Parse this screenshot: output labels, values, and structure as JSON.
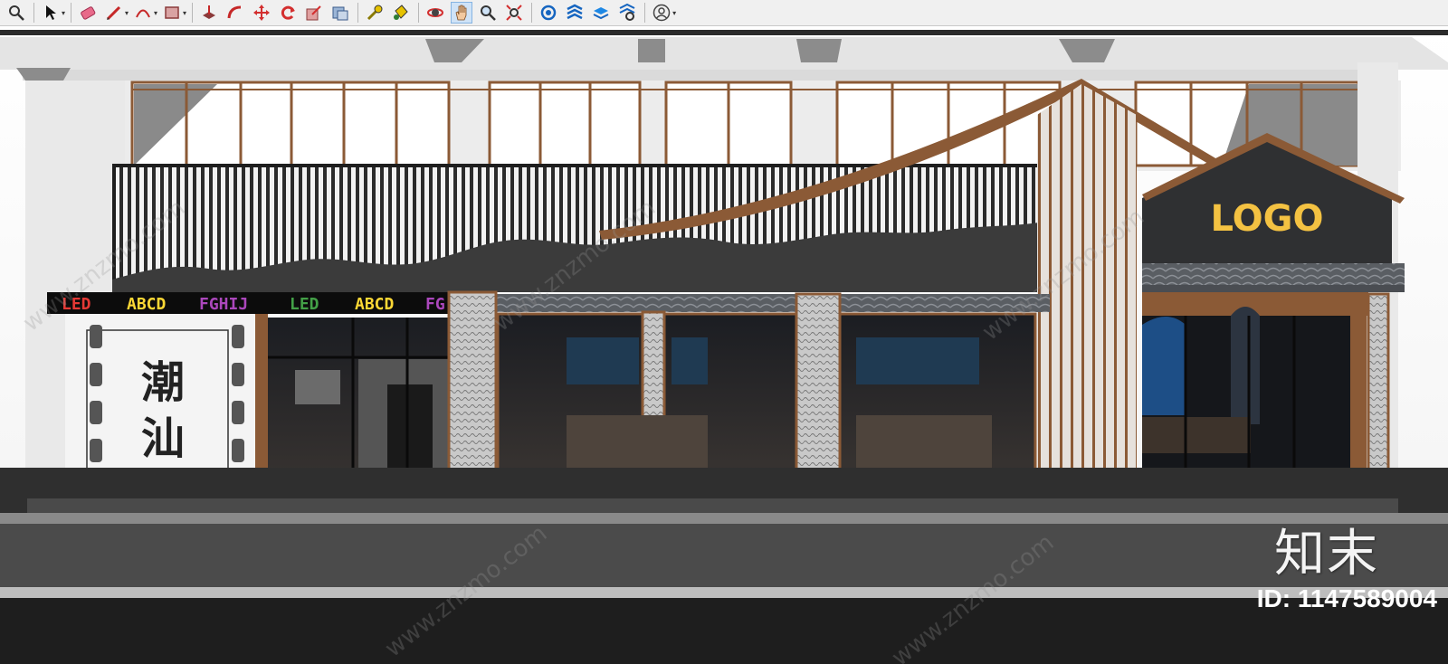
{
  "toolbar": {
    "tools": [
      {
        "name": "zoom-icon"
      },
      {
        "name": "select-icon"
      },
      {
        "name": "eraser-icon"
      },
      {
        "name": "pencil-icon"
      },
      {
        "name": "arc-icon"
      },
      {
        "name": "rectangle-icon"
      },
      {
        "name": "push-pull-icon"
      },
      {
        "name": "follow-me-icon"
      },
      {
        "name": "move-icon"
      },
      {
        "name": "rotate-icon"
      },
      {
        "name": "scale-icon"
      },
      {
        "name": "offset-icon"
      },
      {
        "name": "tape-measure-icon"
      },
      {
        "name": "paint-bucket-icon"
      },
      {
        "name": "orbit-icon"
      },
      {
        "name": "pan-icon"
      },
      {
        "name": "zoom-window-icon"
      },
      {
        "name": "zoom-extents-icon"
      },
      {
        "name": "warehouse-icon"
      },
      {
        "name": "extension-warehouse-icon"
      },
      {
        "name": "layout-icon"
      },
      {
        "name": "extension-manager-icon"
      },
      {
        "name": "account-icon"
      }
    ]
  },
  "scene": {
    "led_sign_text": [
      "LED",
      "ABCD",
      "FGHIJ",
      "LED",
      "ABCD",
      "FG"
    ],
    "plaque_text": [
      "潮",
      "汕"
    ],
    "logo_text": "LOGO",
    "colors": {
      "wood": "#8b5a36",
      "wall": "#e9e9e9",
      "dark_stone": "#3b3b3b",
      "roof_tile": "#5a5e63",
      "logo_yellow": "#f4c242",
      "road": "#3a3a3a"
    }
  },
  "brand_mark": "知末",
  "image_id": "ID: 1147589004",
  "watermark": "www.znzmo.com"
}
